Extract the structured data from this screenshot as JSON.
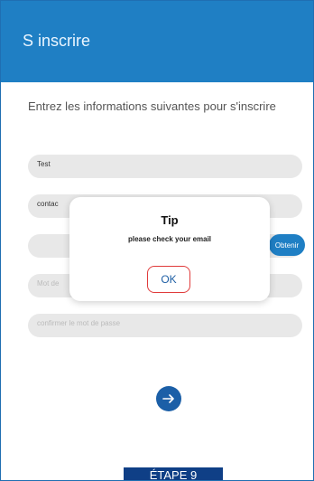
{
  "header": {
    "title": "S inscrire"
  },
  "form": {
    "intro": "Entrez les informations suivantes pour s'inscrire",
    "fields": [
      {
        "value": "Test"
      },
      {
        "value": "contac"
      },
      {
        "value": ""
      },
      {
        "value": "Mot de"
      },
      {
        "value": "confirmer le mot de passe"
      }
    ],
    "get_code_label": "Obtenir"
  },
  "dialog": {
    "title": "Tip",
    "message": "please check your email",
    "ok_label": "OK"
  },
  "footer": {
    "step_label": "ÉTAPE 9"
  },
  "colors": {
    "header_bg": "#1f7fc4",
    "primary": "#1b5fa7",
    "ok_highlight": "#e03b3b",
    "step_label_bg": "#0f3f86"
  }
}
